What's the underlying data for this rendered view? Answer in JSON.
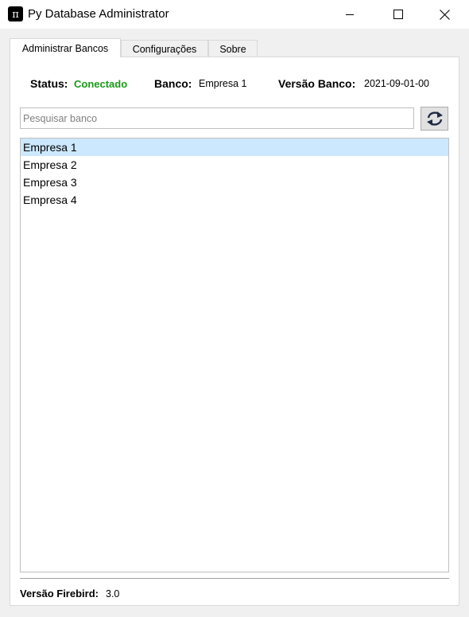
{
  "window": {
    "title": "Py Database Administrator",
    "icon": "pi-icon",
    "icon_glyph": "π",
    "controls": {
      "minimize_icon": "minimize-icon",
      "maximize_icon": "maximize-icon",
      "close_icon": "close-icon"
    }
  },
  "tabs": [
    {
      "label": "Administrar Bancos",
      "active": true
    },
    {
      "label": "Configurações",
      "active": false
    },
    {
      "label": "Sobre",
      "active": false
    }
  ],
  "status_bar": {
    "status_label": "Status:",
    "status_value": "Conectado",
    "status_color": "#1a9a1a",
    "banco_label": "Banco:",
    "banco_value": "Empresa 1",
    "versao_label": "Versão Banco:",
    "versao_value": "2021-09-01-00"
  },
  "search": {
    "placeholder": "Pesquisar banco",
    "value": ""
  },
  "refresh_button": {
    "icon": "refresh-icon"
  },
  "databases": {
    "items": [
      "Empresa 1",
      "Empresa 2",
      "Empresa 3",
      "Empresa 4"
    ],
    "selected": "Empresa 1",
    "selected_color": "#cce8ff"
  },
  "footer": {
    "firebird_label": "Versão Firebird:",
    "firebird_value": "3.0"
  }
}
